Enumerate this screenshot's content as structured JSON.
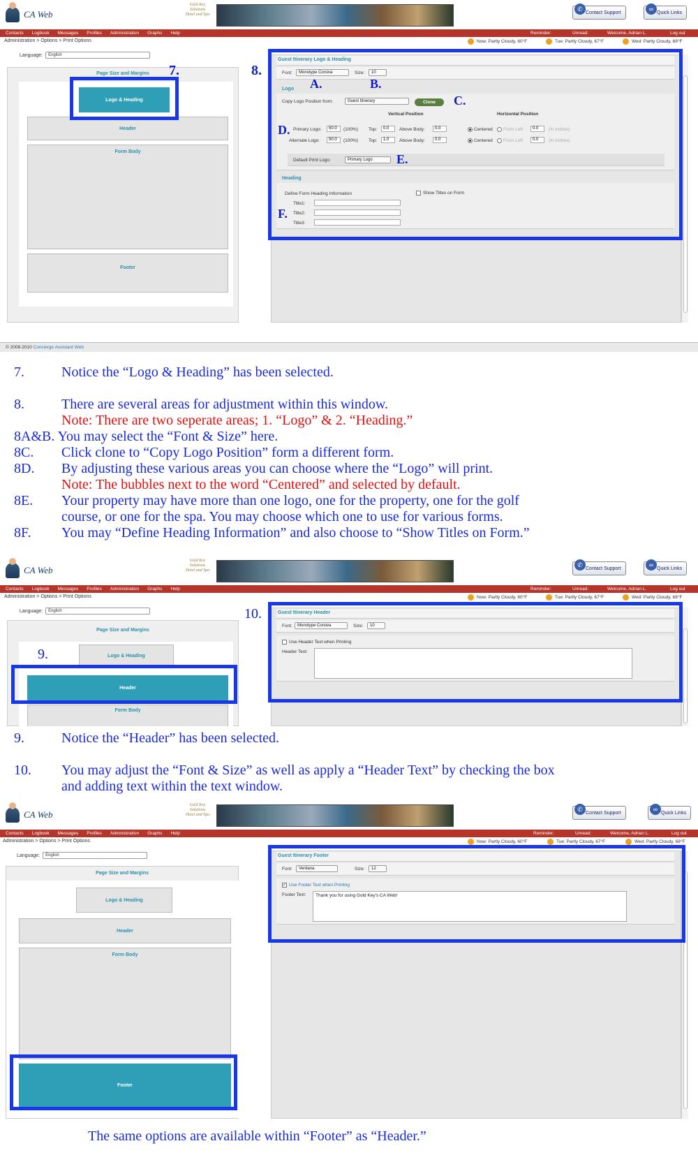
{
  "app": {
    "name": "CA Web",
    "crest_lines": [
      "Gold Key",
      "Solutions",
      "Hotel and Spa"
    ],
    "contact_support": "Contact Support",
    "quick_links": "Quick Links",
    "menu": [
      "Contacts",
      "Logbook",
      "Messages",
      "Profiles",
      "Administration",
      "Graphs",
      "Help"
    ],
    "reminder": "Reminder:",
    "unread": "Unread:",
    "welcome": "Welcome, Adrian L.",
    "logout": "Log out",
    "breadcrumb": "Administration > Options > Print Options",
    "weather": [
      "Now: Partly Cloudy, 60°F",
      "Tue: Partly Cloudy, 67°F",
      "Wed: Partly Cloudy, 68°F"
    ],
    "language_label": "Language:",
    "language_value": "English",
    "footer_copyright": "© 2008-2010",
    "footer_link": "Concierge Assistant Web"
  },
  "layout_sections": {
    "page_size": "Page Size and Margins",
    "logo_heading": "Logo & Heading",
    "header": "Header",
    "form_body": "Form Body",
    "footer": "Footer"
  },
  "shot1": {
    "panel_title": "Guest Itinerary Logo & Heading",
    "font_label": "Font:",
    "font_value": "Monotype Corsiva",
    "size_label": "Size:",
    "size_value": "10",
    "logo_section": "Logo",
    "copy_label": "Copy Logo Position from:",
    "copy_value": "Guest Itinerary",
    "clone_label": "Clone",
    "vertical_position": "Vertical Position",
    "horizontal_position": "Horizontal Position",
    "primary_logo_label": "Primary Logo:",
    "primary_logo_value": "50.0",
    "alternate_logo_label": "Alternate Logo:",
    "alternate_logo_value": "50.0",
    "percent": "(100%)",
    "top_label": "Top:",
    "top_primary": "0.0",
    "top_alternate": "1.0",
    "above_body_label": "Above Body:",
    "above_body_primary": "0.0",
    "above_body_alternate": "0.0",
    "centered": "Centered",
    "from_left": "From Left:",
    "from_left_value": "0.0",
    "in_inches": "(In inches)",
    "default_print_logo_label": "Default Print Logo:",
    "default_print_logo_value": "Primary Logo",
    "heading_section": "Heading",
    "define_heading": "Define Form Heading Information",
    "show_titles": "Show Titles on Form",
    "title1": "Title1:",
    "title2": "Title2:",
    "title3": "Title3:",
    "callouts": {
      "seven": "7.",
      "eight": "8.",
      "a": "A.",
      "b": "B.",
      "c": "C.",
      "d": "D.",
      "e": "E.",
      "f": "F."
    }
  },
  "instructions1": {
    "n7": "7.",
    "t7": "Notice the “Logo & Heading” has been selected.",
    "n8": "8.",
    "t8": "There are several areas for adjustment within this window.",
    "t8note": "Note:  There are two seperate areas; 1. “Logo”  &  2. “Heading.”",
    "t8ab": "8A&B. You may select the “Font & Size” here.",
    "n8c": "8C.",
    "t8c": "Click clone to “Copy Logo Position” form a different form.",
    "n8d": "8D.",
    "t8d": "By adjusting these various areas you can choose where the “Logo” will print.",
    "t8dnote": "Note:  The bubbles next to the word “Centered” and selected by default.",
    "n8e": "8E.",
    "t8e1": "Your property may have more than one logo, one for the property, one for the golf",
    "t8e2": "course, or one for the spa.  You may choose which one to use for various forms.",
    "n8f": "8F.",
    "t8f": "You may “Define Heading Information” and also choose to “Show Titles on Form.”"
  },
  "shot2": {
    "panel_title": "Guest Itinerary Header",
    "font_label": "Font:",
    "font_value": "Monotype Corsiva",
    "size_label": "Size:",
    "size_value": "10",
    "use_header_text": "Use Header Text when Printing",
    "header_text_label": "Header Text:",
    "callouts": {
      "nine": "9.",
      "ten": "10."
    }
  },
  "instructions2": {
    "n9": "9.",
    "t9": "Notice the “Header” has been selected.",
    "n10": "10.",
    "t10a": "You may adjust the “Font & Size” as well as apply a “Header Text” by checking the box",
    "t10b": "and adding text within the text window."
  },
  "shot3": {
    "panel_title": "Guest Itinerary Footer",
    "font_label": "Font:",
    "font_value": "Verdana",
    "size_label": "Size:",
    "size_value": "12",
    "use_footer_text": "Use Footer Text when Printing",
    "footer_text_label": "Footer Text:",
    "footer_text_value": "Thank you for using Gold Key's CA Web!"
  },
  "final_note": "The same options are available within “Footer” as “Header.”"
}
